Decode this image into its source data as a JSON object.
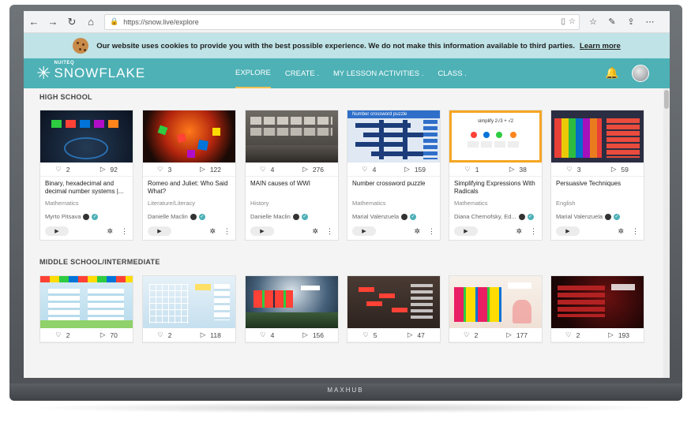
{
  "browser": {
    "url": "https://snow.live/explore",
    "back": "←",
    "forward": "→",
    "refresh": "↻",
    "home": "⌂"
  },
  "cookie": {
    "message": "Our website uses cookies to provide you with the best possible experience. We do not make this information available to third parties.",
    "link": "Learn more"
  },
  "header": {
    "logo_sup": "NUITEQ",
    "logo_text": "SNOWFLAKE",
    "menu": [
      {
        "label": "EXPLORE"
      },
      {
        "label": "CREATE ."
      },
      {
        "label": "MY LESSON ACTIVITIES ."
      },
      {
        "label": "CLASS ."
      }
    ]
  },
  "sections": [
    {
      "title": "HIGH SCHOOL",
      "cards": [
        {
          "likes": "2",
          "plays": "92",
          "title": "Binary, hexadecimal and decimal number systems |...",
          "subject": "Mathematics",
          "author": "Myrto Pitsava"
        },
        {
          "likes": "3",
          "plays": "122",
          "title": "Romeo and Juliet: Who Said What?",
          "subject": "Literature/Literacy",
          "author": "Danielle Maclin"
        },
        {
          "likes": "4",
          "plays": "276",
          "title": "MAIN causes of WWI",
          "subject": "History",
          "author": "Danielle Maclin"
        },
        {
          "likes": "4",
          "plays": "159",
          "title": "Number crossword puzzle",
          "subject": "Mathematics",
          "author": "Marial Valenzuela"
        },
        {
          "likes": "1",
          "plays": "38",
          "title": "Simplifying Expressions With Radicals",
          "subject": "Mathematics",
          "author": "Diana Chernofsky, Ed..."
        },
        {
          "likes": "3",
          "plays": "59",
          "title": "Persuasive Techniques",
          "subject": "English",
          "author": "Marial Valenzuela"
        }
      ]
    },
    {
      "title": "MIDDLE SCHOOL/INTERMEDIATE",
      "cards": [
        {
          "likes": "2",
          "plays": "70"
        },
        {
          "likes": "2",
          "plays": "118"
        },
        {
          "likes": "4",
          "plays": "156"
        },
        {
          "likes": "5",
          "plays": "47"
        },
        {
          "likes": "2",
          "plays": "177"
        },
        {
          "likes": "2",
          "plays": "193"
        }
      ]
    }
  ],
  "thumb_text": {
    "crossword": "Number crossword puzzle",
    "simplify": "simplify  2√3 + √2"
  },
  "device_brand": "MAXHUB",
  "colors": {
    "header": "#4db1b6",
    "cookie": "#bfe3e6",
    "accent": "#f6c253"
  }
}
